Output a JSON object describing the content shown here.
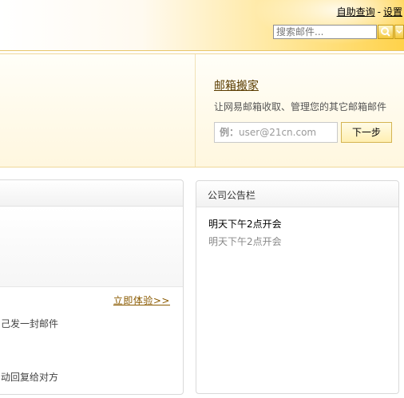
{
  "header": {
    "links": [
      "自助查询",
      "设置"
    ],
    "separator": "-",
    "search": {
      "placeholder": "搜索邮件..."
    }
  },
  "mail_move": {
    "title": "邮箱搬家",
    "description": "让网易邮箱收取、管理您的其它邮箱邮件",
    "input_prefix": "例：",
    "input_placeholder": "user@21cn.com",
    "next_button": "下一步"
  },
  "left_panel": {
    "try_link": "立即体验>>",
    "line1": "己发一封邮件",
    "line2": "动回复给对方"
  },
  "right_panel": {
    "title": "公司公告栏",
    "notice_title": "明天下午2点开会",
    "notice_body": "明天下午2点开会"
  },
  "colors": {
    "header_gold": "#ffd24a",
    "banner_bg": "#fff7df",
    "link_brown": "#8a5a00"
  }
}
